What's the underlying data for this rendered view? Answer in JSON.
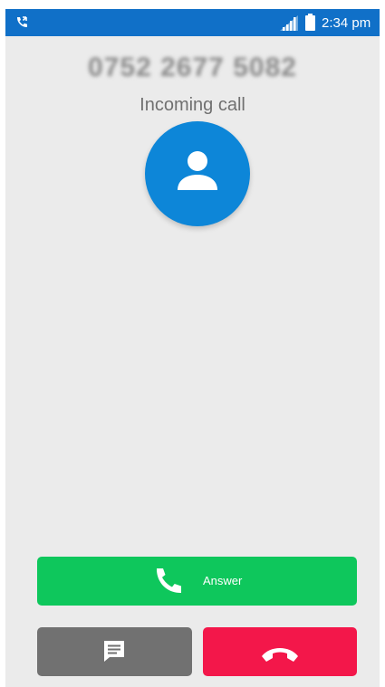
{
  "status_bar": {
    "time": "2:34 pm",
    "left_icon": "incoming-call-icon",
    "right_icons": [
      "signal-icon",
      "battery-icon"
    ]
  },
  "call": {
    "caller_number": "0752 2677 5082",
    "state": "Incoming call",
    "avatar_icon": "person-icon"
  },
  "actions": {
    "answer_label": "Answer",
    "answer_icon": "phone-icon",
    "message_icon": "message-icon",
    "decline_icon": "hang-up-icon"
  },
  "colors": {
    "status_bar": "#1070c8",
    "background": "#ebebeb",
    "avatar": "#0d86d8",
    "answer": "#0ec75c",
    "message": "#717171",
    "decline": "#f3174a"
  }
}
